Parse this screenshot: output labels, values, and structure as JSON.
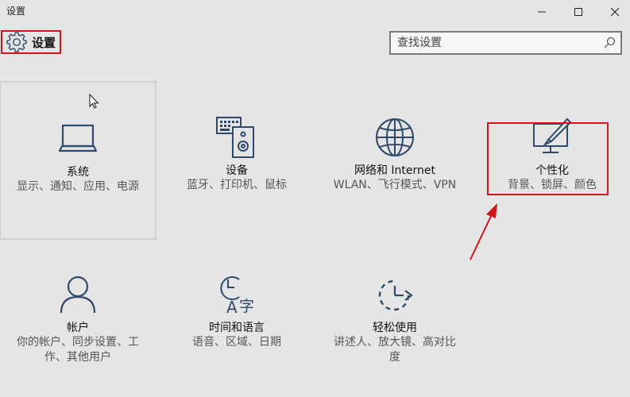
{
  "window": {
    "title": "设置"
  },
  "app": {
    "title": "设置"
  },
  "search": {
    "placeholder": "查找设置"
  },
  "tiles": [
    {
      "name": "系统",
      "desc": "显示、通知、应用、电源"
    },
    {
      "name": "设备",
      "desc": "蓝牙、打印机、鼠标"
    },
    {
      "name": "网络和 Internet",
      "desc": "WLAN、飞行模式、VPN"
    },
    {
      "name": "个性化",
      "desc": "背景、锁屏、颜色"
    },
    {
      "name": "帐户",
      "desc": "你的帐户、同步设置、工作、其他用户"
    },
    {
      "name": "时间和语言",
      "desc": "语音、区域、日期"
    },
    {
      "name": "轻松使用",
      "desc": "讲述人、放大镜、高对比度"
    }
  ],
  "colors": {
    "icon": "#2e4a6a",
    "annotation": "#d0161b"
  },
  "icons": {
    "system": "laptop-icon",
    "devices": "keyboard-speaker-icon",
    "network": "globe-icon",
    "personalization": "monitor-brush-icon",
    "accounts": "person-icon",
    "time_language": "clock-language-icon",
    "ease_of_access": "ease-of-access-icon"
  }
}
